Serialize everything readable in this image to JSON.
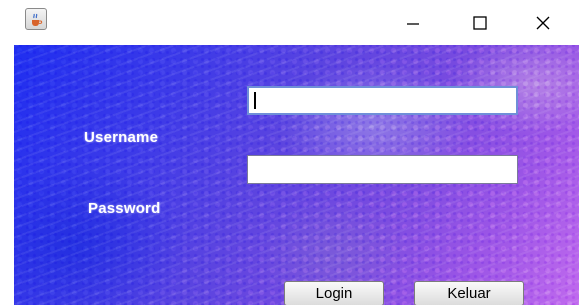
{
  "window": {
    "icon": "java-coffee-icon",
    "controls": {
      "minimize_icon": "minimize-icon",
      "maximize_icon": "maximize-icon",
      "close_icon": "close-icon"
    }
  },
  "form": {
    "username_label": "Username",
    "username_value": "",
    "password_label": "Password",
    "password_value": "",
    "login_button": "Login",
    "exit_button": "Keluar"
  },
  "colors": {
    "background_blue": "#1f2ef0",
    "background_purple": "#9b55e6"
  }
}
